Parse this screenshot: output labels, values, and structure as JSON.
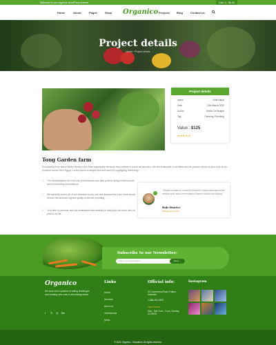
{
  "topbar": {
    "welcome": "Welcome to our organics WordPress theme!",
    "cart": "Cart: 0 - $0.00"
  },
  "nav": {
    "logo": "Organico",
    "items": [
      "Home",
      "About",
      "Pages",
      "Shop",
      "Projects",
      "Blog",
      "Contact us"
    ],
    "search_icon": "search-icon"
  },
  "hero": {
    "title": "Project details",
    "breadcrumb": "Home  ›  Project details"
  },
  "project_card": {
    "title": "Project details",
    "rows": [
      {
        "label": "Name",
        "value": "Rubi Navar"
      },
      {
        "label": "Date",
        "value": "24th March 2020"
      },
      {
        "label": "Author",
        "value": "Martin De Bragon"
      },
      {
        "label": "Tag",
        "value": "Cleaning, Plumbing"
      }
    ],
    "value_label": "Value :",
    "value": "$125",
    "stars": "★★★★★"
  },
  "content": {
    "heading": "Tong Garden farm",
    "paragraph": "Purchasing from select family farmers who farm organically because they believe in it and we are also. We are enterprise of all miles and we partner hence to give a lot of our produce comes from Egypt. Lorem ipsum is simply free text used by copytyping refreshing.",
    "bullets": [
      "The housekeepers we hired are professionals who take pride in doing excellent work and in exceeding expectations.",
      "We carefully screen all of our cleaners so you can rest assured that your home would receive the absolute highest quality of service providing.",
      "Your time is precious, and we understand that cleaning is really just one more item on your to-do list."
    ],
    "check_icon": "check-icon"
  },
  "testimonial": {
    "text": "“Tempor incididunt ut labore et dolore magna aliqu quis enim veniam quis nostru exercitation ullamco laboris nisi aliquip.”",
    "name": "Bob Hunter",
    "role": "Managing Director",
    "quote_icon": "quote-icon"
  },
  "newsletter": {
    "title": "Subscribe to our Newsletter:",
    "placeholder": "Enter your email address...",
    "button": "Send →"
  },
  "footer": {
    "logo": "Organico",
    "description": "We work with a passion of taking challenges and creating new ones in advertising sector.",
    "social": [
      "f",
      "𝕏",
      "◎",
      "Be"
    ],
    "links_title": "Links",
    "links": [
      "Home",
      "Services",
      "About us",
      "Testimonials",
      "News"
    ],
    "info_title": "Official info:",
    "info": {
      "address": "30 Commercial Road Fratton, Australia",
      "phone": "1-888-452-1505",
      "open_label": "Open Hours:",
      "hours": "Mon - Sat: 8 am - 5 pm, Sunday: CLOSED"
    },
    "insta_title": "Instagram",
    "copyright": "© 2021 Organico - Education. All rights reserved."
  },
  "colors": {
    "brand_green": "#5aa72e",
    "footer_green": "#2f7f16",
    "star": "#f5a623"
  }
}
